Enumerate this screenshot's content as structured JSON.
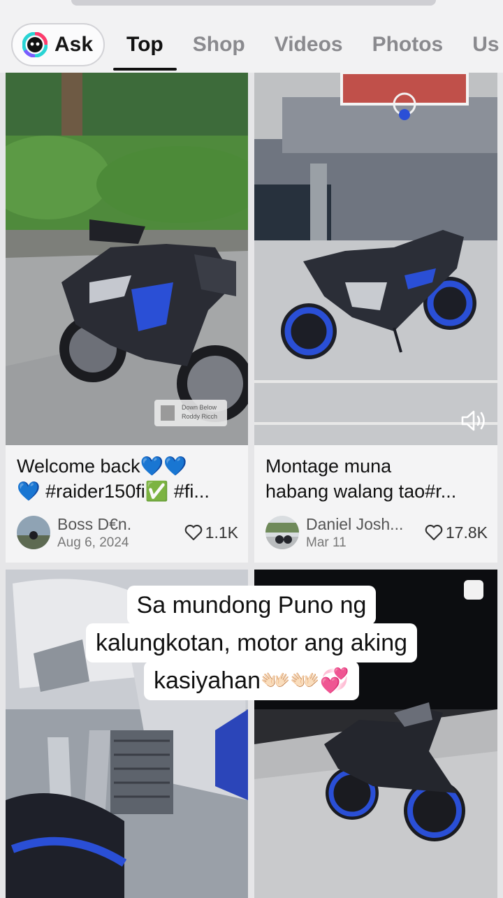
{
  "header": {
    "ask_label": "Ask",
    "tabs": [
      {
        "label": "Top",
        "active": true
      },
      {
        "label": "Shop",
        "active": false
      },
      {
        "label": "Videos",
        "active": false
      },
      {
        "label": "Photos",
        "active": false
      },
      {
        "label": "Us",
        "active": false
      }
    ]
  },
  "results": [
    {
      "caption_line1": "Welcome back💙💙",
      "caption_line2": "💙 #raider150fi✅ #fi...",
      "author": "Boss D€n.",
      "date": "Aug 6, 2024",
      "likes": "1.1K",
      "music_badge_line1": "Down Below",
      "music_badge_line2": "Roddy Ricch"
    },
    {
      "caption_line1": "Montage muna",
      "caption_line2": "habang walang tao#r...",
      "author": "Daniel Josh...",
      "date": "Mar 11",
      "likes": "17.8K",
      "sound_icon": "speaker-icon"
    }
  ],
  "overlay_text": {
    "line1": "Sa mundong Puno ng",
    "line2": "kalungkotan, motor ang aking",
    "line3": "kasiyahan👐🏻👐🏻💞"
  },
  "colors": {
    "accent_blue": "#2a4fd6",
    "background": "#e6e6e8",
    "card_background": "#f4f4f5"
  }
}
